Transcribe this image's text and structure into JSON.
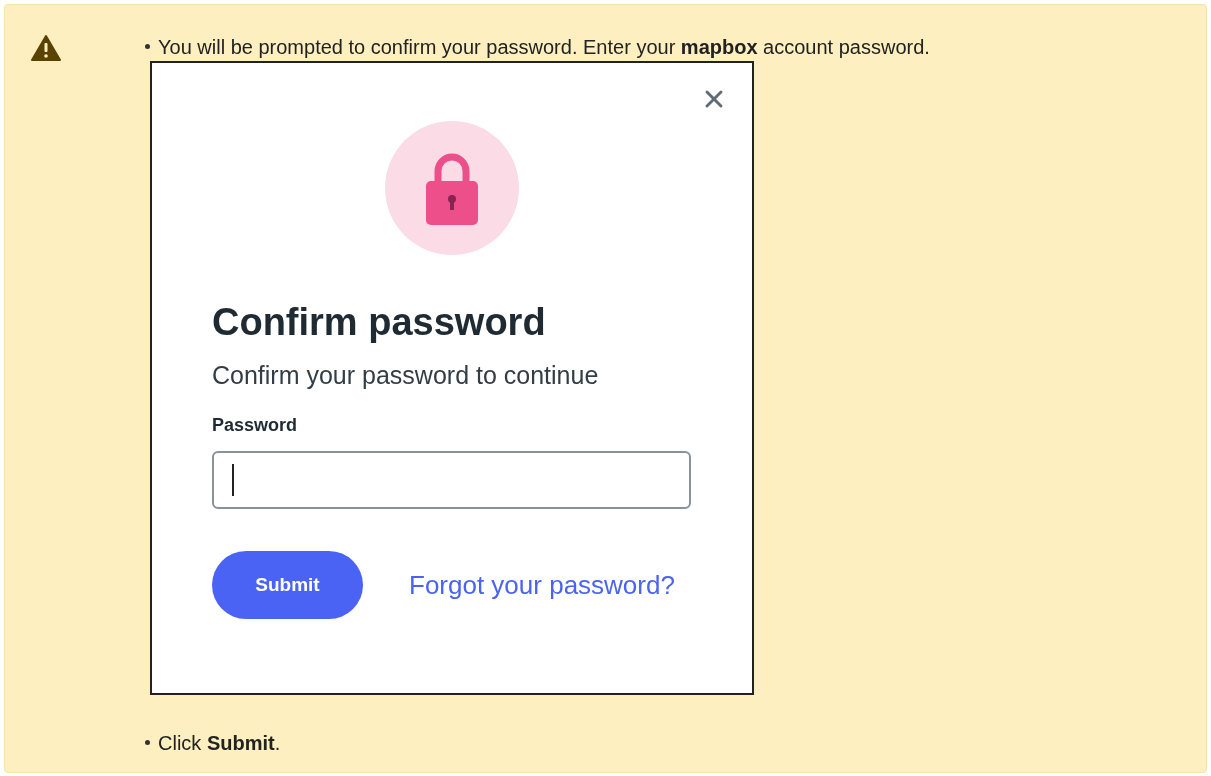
{
  "callout": {
    "items": [
      {
        "text": "You will be prompted to confirm your password. Enter your **mapbox** account password.",
        "screenshot": {
          "dialog": {
            "title": "Confirm password",
            "subtitle": "Confirm your password to continue",
            "field_label": "Password",
            "submit_button": "Submit",
            "forgot_link": "Forgot your password?"
          }
        }
      },
      {
        "text": "Click **Submit**."
      }
    ]
  }
}
